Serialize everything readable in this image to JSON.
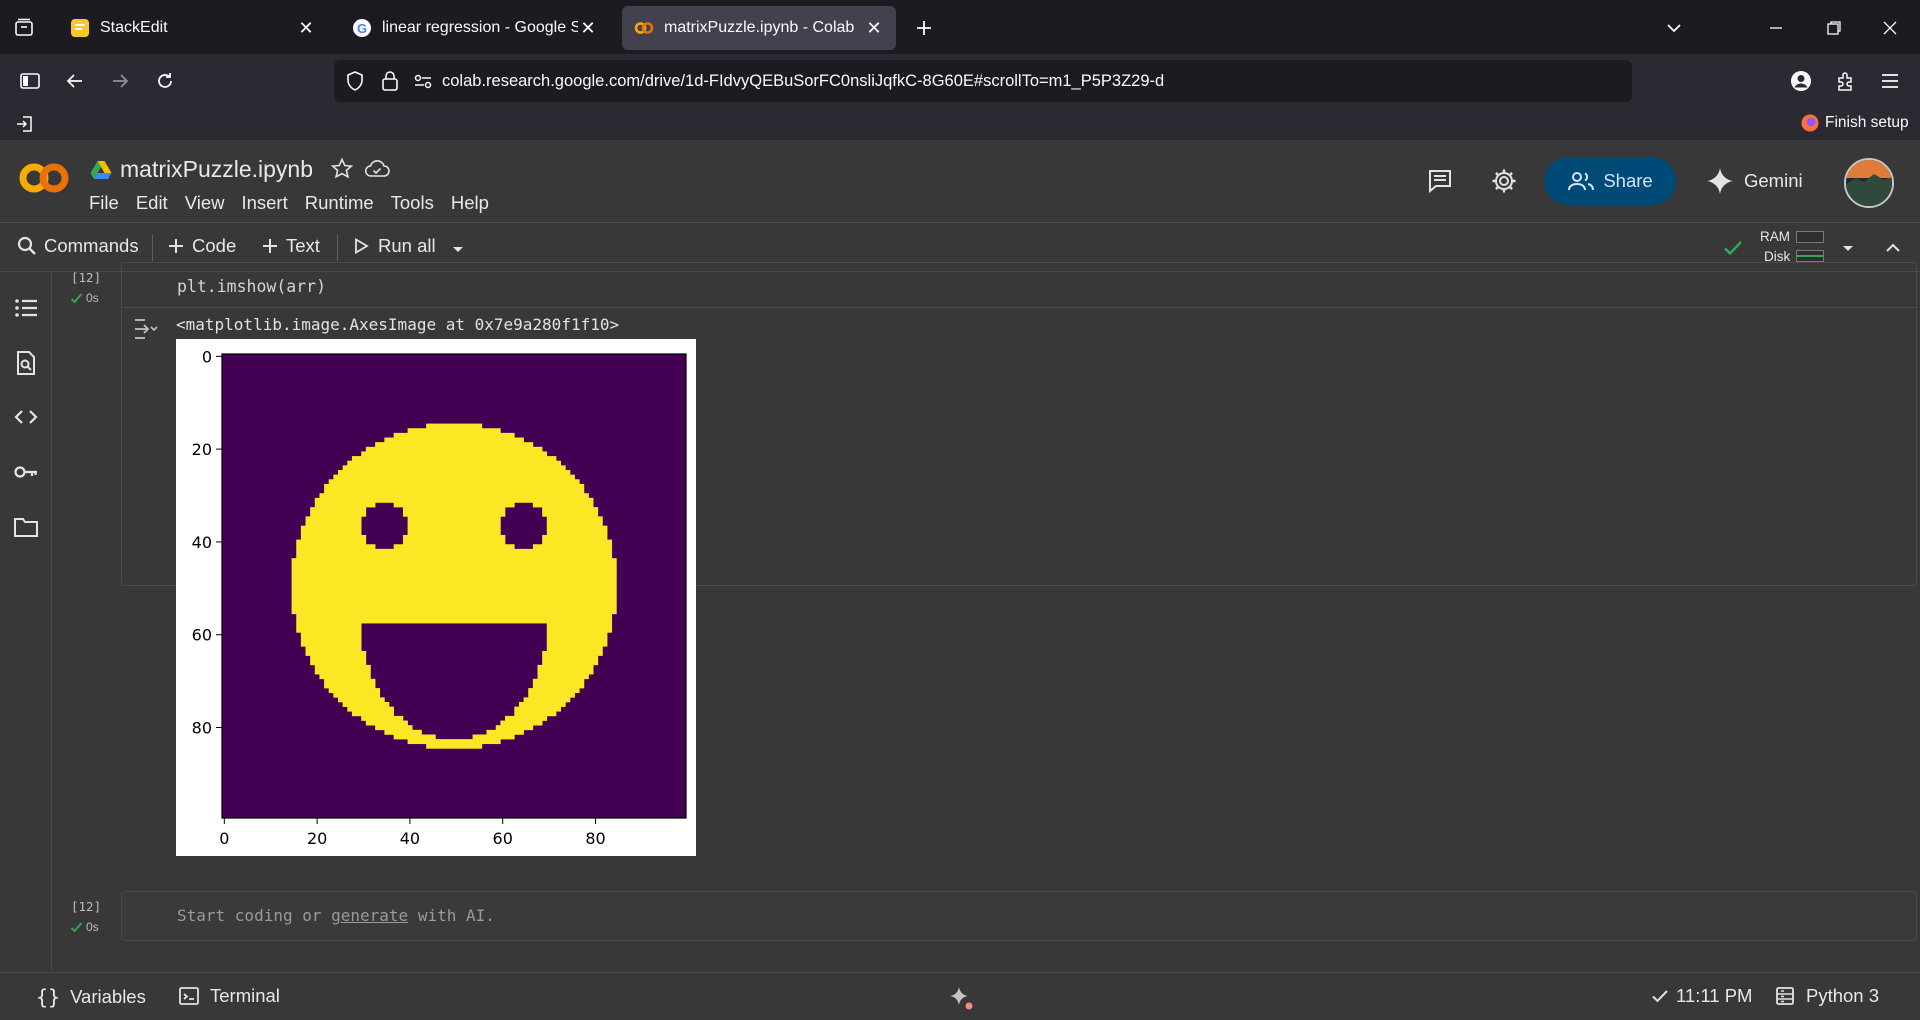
{
  "browser": {
    "tabs": [
      {
        "title": "StackEdit",
        "active": false
      },
      {
        "title": "linear regression - Google Searc",
        "active": false
      },
      {
        "title": "matrixPuzzle.ipynb - Colab",
        "active": true
      }
    ],
    "url": "colab.research.google.com/drive/1d-FIdvyQEBuSorFC0nsliJqfkC-8G60E#scrollTo=m1_P5P3Z29-d",
    "finish_setup": "Finish setup"
  },
  "colab": {
    "notebook_title": "matrixPuzzle.ipynb",
    "menu": [
      "File",
      "Edit",
      "View",
      "Insert",
      "Runtime",
      "Tools",
      "Help"
    ],
    "share_label": "Share",
    "gemini_label": "Gemini",
    "toolbar": {
      "commands": "Commands",
      "code": "Code",
      "text": "Text",
      "run_all": "Run all",
      "ram": "RAM",
      "disk": "Disk"
    }
  },
  "cells": [
    {
      "exec_count": "[12]",
      "duration": "0s",
      "code": "plt.imshow(arr)",
      "output_text": "<matplotlib.image.AxesImage at 0x7e9a280f1f10>"
    },
    {
      "exec_count": "[12]",
      "duration": "0s",
      "placeholder_prefix": "Start coding or ",
      "placeholder_link": "generate",
      "placeholder_suffix": " with AI."
    }
  ],
  "chart_data": {
    "type": "heatmap",
    "title": "",
    "colormap": "viridis",
    "colors": {
      "background": "#440154",
      "foreground": "#fde725"
    },
    "extent": [
      0,
      100,
      0,
      100
    ],
    "xticks": [
      "0",
      "20",
      "40",
      "60",
      "80"
    ],
    "yticks": [
      "0",
      "20",
      "40",
      "60",
      "80"
    ],
    "shapes": [
      {
        "kind": "disk",
        "label": "face",
        "center": [
          50,
          50
        ],
        "radius": 35,
        "value": 1
      },
      {
        "kind": "disk",
        "label": "left eye",
        "center": [
          35,
          37
        ],
        "radius": 5,
        "value": 0
      },
      {
        "kind": "disk",
        "label": "right eye",
        "center": [
          65,
          37
        ],
        "radius": 5,
        "value": 0
      },
      {
        "kind": "half-ellipse",
        "label": "mouth",
        "center": [
          50,
          58
        ],
        "rx": 20,
        "ry": 25,
        "value": 0
      }
    ]
  },
  "statusbar": {
    "variables": "Variables",
    "terminal": "Terminal",
    "time": "11:11 PM",
    "runtime": "Python 3"
  },
  "theme": {
    "accent": "#004a77",
    "ok": "#34a853",
    "colab_orange": "#f9ab00"
  }
}
